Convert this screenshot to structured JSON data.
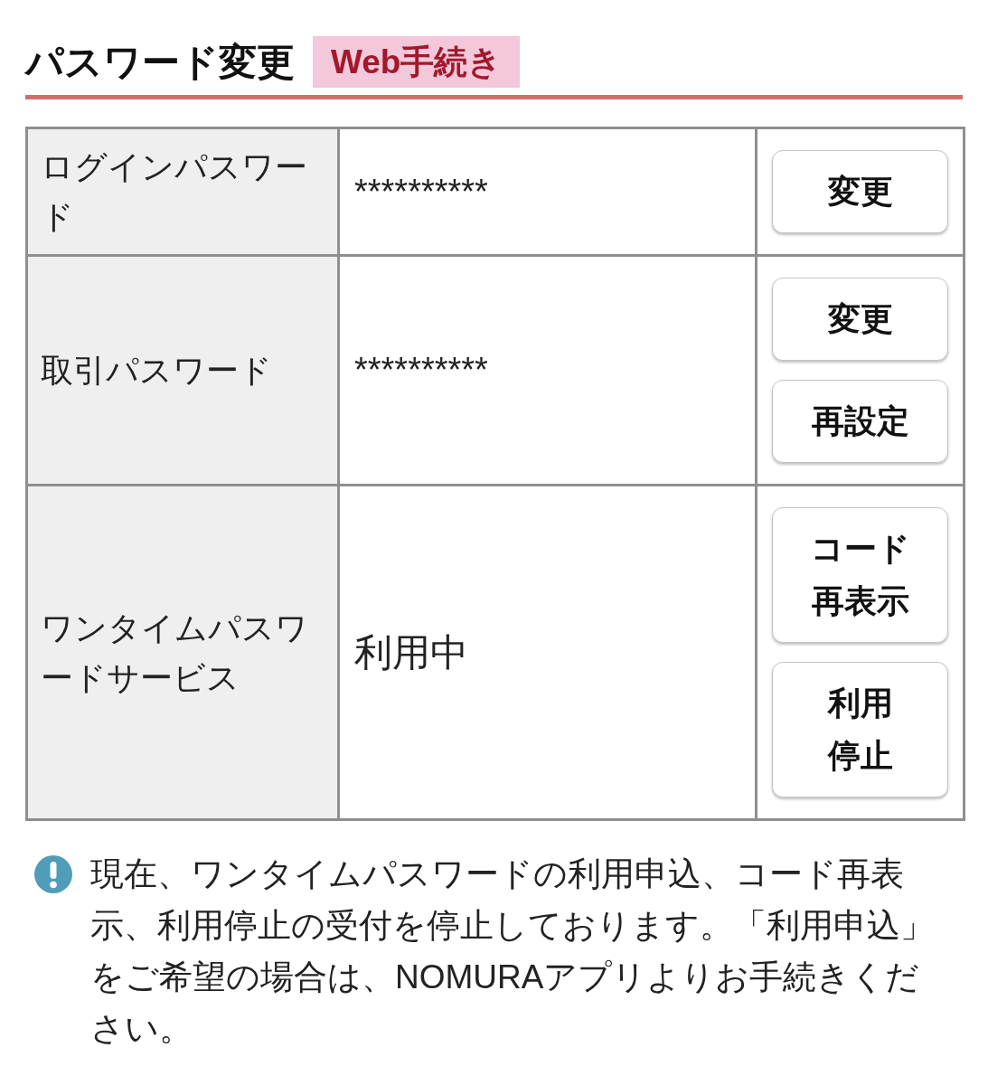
{
  "section": {
    "title": "パスワード変更",
    "badge": "Web手続き"
  },
  "rows": [
    {
      "kind": "password",
      "label": "ログインパスワード",
      "value": "**********",
      "buttons": [
        "変更"
      ]
    },
    {
      "kind": "password",
      "label": "取引パスワード",
      "value": "**********",
      "buttons": [
        "変更",
        "再設定"
      ]
    },
    {
      "kind": "service",
      "label": "ワンタイムパスワードサービス",
      "value": "利用中",
      "buttons": [
        "コード再表示",
        "利用停止"
      ]
    }
  ],
  "notice": {
    "text": "現在、ワンタイムパスワードの利用申込、コード再表示、利用停止の受付を停止しております。「利用申込」をご希望の場合は、NOMURAアプリよりお手続きください。"
  }
}
